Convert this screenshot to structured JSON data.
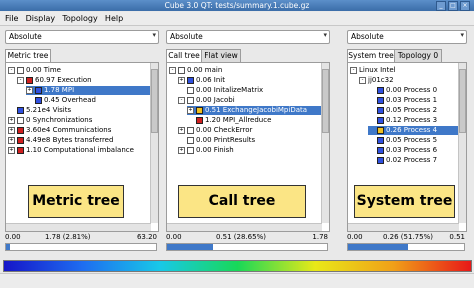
{
  "window": {
    "title": "Cube 3.0 QT: tests/summary.1.cube.gz"
  },
  "menu": [
    "File",
    "Display",
    "Topology",
    "Help"
  ],
  "combos": {
    "left": "Absolute",
    "middle": "Absolute",
    "right": "Absolute"
  },
  "tabs": {
    "left": [
      "Metric tree"
    ],
    "middle": [
      "Call tree",
      "Flat view"
    ],
    "right": [
      "System tree",
      "Topology 0"
    ]
  },
  "metric_tree": [
    {
      "indent": 0,
      "expander": "-",
      "check": true,
      "color": "",
      "label": "0.00 Time",
      "selected": false
    },
    {
      "indent": 1,
      "expander": "-",
      "check": false,
      "color": "#d02020",
      "label": "60.97 Execution",
      "selected": false
    },
    {
      "indent": 2,
      "expander": "+",
      "check": false,
      "color": "#3050e0",
      "label": "1.78 MPI",
      "selected": true
    },
    {
      "indent": 2,
      "expander": "",
      "check": false,
      "color": "#3050e0",
      "label": "0.45 Overhead",
      "selected": false
    },
    {
      "indent": 0,
      "expander": "",
      "check": false,
      "color": "#3050e0",
      "label": "5.21e4 Visits",
      "selected": false
    },
    {
      "indent": 0,
      "expander": "+",
      "check": true,
      "color": "",
      "label": "0 Synchronizations",
      "selected": false
    },
    {
      "indent": 0,
      "expander": "+",
      "check": false,
      "color": "#d02020",
      "label": "3.60e4 Communications",
      "selected": false
    },
    {
      "indent": 0,
      "expander": "+",
      "check": false,
      "color": "#d02020",
      "label": "4.49e8 Bytes transferred",
      "selected": false
    },
    {
      "indent": 0,
      "expander": "+",
      "check": false,
      "color": "#d02020",
      "label": "1.10 Computational imbalance",
      "selected": false
    }
  ],
  "call_tree": [
    {
      "indent": 0,
      "expander": "-",
      "check": true,
      "color": "",
      "label": "0.00 main",
      "selected": false
    },
    {
      "indent": 1,
      "expander": "+",
      "check": false,
      "color": "#3050e0",
      "label": "0.06 Init",
      "selected": false
    },
    {
      "indent": 1,
      "expander": "",
      "check": true,
      "color": "",
      "label": "0.00 InitalizeMatrix",
      "selected": false
    },
    {
      "indent": 1,
      "expander": "-",
      "check": true,
      "color": "",
      "label": "0.00 Jacobi",
      "selected": false
    },
    {
      "indent": 2,
      "expander": "+",
      "check": false,
      "color": "#f0c020",
      "label": "0.51 ExchangeJacobiMpiData",
      "selected": true
    },
    {
      "indent": 2,
      "expander": "",
      "check": false,
      "color": "#d02020",
      "label": "1.20 MPI_Allreduce",
      "selected": false
    },
    {
      "indent": 1,
      "expander": "+",
      "check": true,
      "color": "",
      "label": "0.00 CheckError",
      "selected": false
    },
    {
      "indent": 1,
      "expander": "",
      "check": true,
      "color": "",
      "label": "0.00 PrintResults",
      "selected": false
    },
    {
      "indent": 1,
      "expander": "+",
      "check": true,
      "color": "",
      "label": "0.00 Finish",
      "selected": false
    }
  ],
  "system_tree": [
    {
      "indent": 0,
      "expander": "-",
      "check": false,
      "color": "",
      "label": "Linux Intel",
      "selected": false
    },
    {
      "indent": 1,
      "expander": "-",
      "check": false,
      "color": "",
      "label": "jj01c32",
      "selected": false
    },
    {
      "indent": 2,
      "expander": "",
      "check": false,
      "color": "#3050e0",
      "label": "0.00 Process 0",
      "selected": false
    },
    {
      "indent": 2,
      "expander": "",
      "check": false,
      "color": "#3050e0",
      "label": "0.03 Process 1",
      "selected": false
    },
    {
      "indent": 2,
      "expander": "",
      "check": false,
      "color": "#3050e0",
      "label": "0.05 Process 2",
      "selected": false
    },
    {
      "indent": 2,
      "expander": "",
      "check": false,
      "color": "#3050e0",
      "label": "0.12 Process 3",
      "selected": false
    },
    {
      "indent": 2,
      "expander": "",
      "check": false,
      "color": "#f0c020",
      "label": "0.26 Process 4",
      "selected": true
    },
    {
      "indent": 2,
      "expander": "",
      "check": false,
      "color": "#3050e0",
      "label": "0.05 Process 5",
      "selected": false
    },
    {
      "indent": 2,
      "expander": "",
      "check": false,
      "color": "#3050e0",
      "label": "0.03 Process 6",
      "selected": false
    },
    {
      "indent": 2,
      "expander": "",
      "check": false,
      "color": "#3050e0",
      "label": "0.02 Process 7",
      "selected": false
    }
  ],
  "overlays": {
    "left": "Metric tree",
    "middle": "Call tree",
    "right": "System tree"
  },
  "scales": {
    "left": {
      "min": "0.00",
      "value": "1.78 (2.81%)",
      "max": "63.20",
      "fraction": 0.0281
    },
    "middle": {
      "min": "0.00",
      "value": "0.51 (28.65%)",
      "max": "1.78",
      "fraction": 0.2865
    },
    "right": {
      "min": "0.00",
      "value": "0.26 (51.75%)",
      "max": "0.51",
      "fraction": 0.5175
    }
  },
  "colors": {
    "selection": "#3f78c8",
    "overlay_bg": "#fbe585"
  }
}
